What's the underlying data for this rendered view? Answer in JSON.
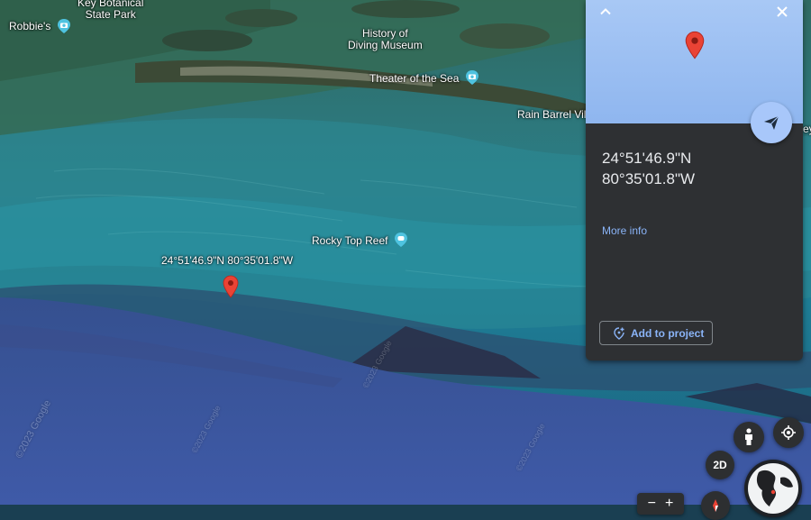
{
  "map": {
    "labels": {
      "botanical": "Key Botanical\nState Park",
      "robbies": "Robbie's",
      "history": "History of\nDiving Museum",
      "theater": "Theater of the Sea",
      "rainbarrel": "Rain Barrel Vil",
      "edge": "ey",
      "rockytop": "Rocky Top Reef",
      "pin_coords": "24°51'46.9\"N 80°35'01.8\"W"
    },
    "watermarks": [
      "©2023 Google",
      "©2023 Google",
      "©2023 Google",
      "©2023 Google"
    ],
    "colors": {
      "pin": "#ea4335",
      "poi": "#4fc3e0"
    }
  },
  "panel": {
    "lat": "24°51'46.9\"N",
    "lng": "80°35'01.8\"W",
    "more_info": "More info",
    "add_to_project": "Add to project"
  },
  "controls": {
    "mode_2d": "2D",
    "zoom_out": "−",
    "zoom_in": "+"
  }
}
